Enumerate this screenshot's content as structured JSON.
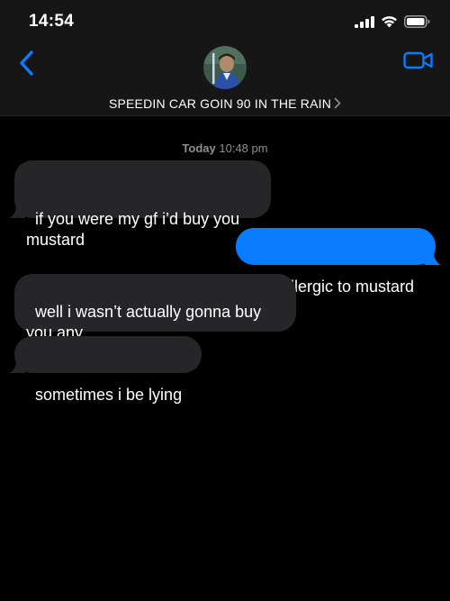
{
  "status_bar": {
    "time": "14:54"
  },
  "header": {
    "contact_name": "SPEEDIN CAR GOIN 90 IN THE RAIN",
    "back_icon": "chevron-left-icon",
    "video_icon": "video-camera-icon"
  },
  "conversation": {
    "timestamp_day": "Today",
    "timestamp_time": "10:48 pm",
    "messages": [
      {
        "direction": "incoming",
        "text": "if you were my gf i’d buy you mustard"
      },
      {
        "direction": "outgoing",
        "text": "i’m allergic to mustard"
      },
      {
        "direction": "incoming",
        "text": "well i wasn’t actually gonna buy you any"
      },
      {
        "direction": "incoming",
        "text": "sometimes i be lying"
      }
    ]
  },
  "colors": {
    "accent": "#0a7cff",
    "incoming_bubble": "#262629",
    "background": "#000000",
    "secondary_text": "#8e8e93"
  }
}
